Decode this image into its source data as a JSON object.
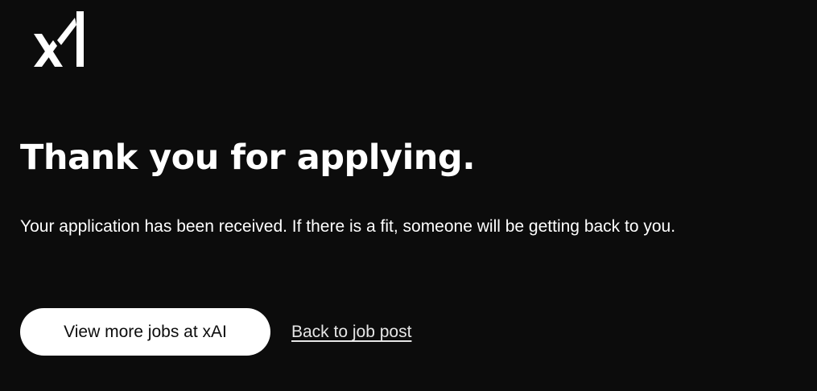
{
  "brand": {
    "logo_icon": "xai-logo-icon",
    "logo_color": "#ffffff"
  },
  "main": {
    "title": "Thank you for applying.",
    "message": "Your application has been received. If there is a fit, someone will be getting back to you."
  },
  "actions": {
    "primary_label": "View more jobs at xAI",
    "back_label": "Back to job post"
  },
  "colors": {
    "background": "#0c0c0c",
    "text": "#ffffff",
    "button_bg": "#ffffff",
    "button_text": "#0c0c0c"
  }
}
